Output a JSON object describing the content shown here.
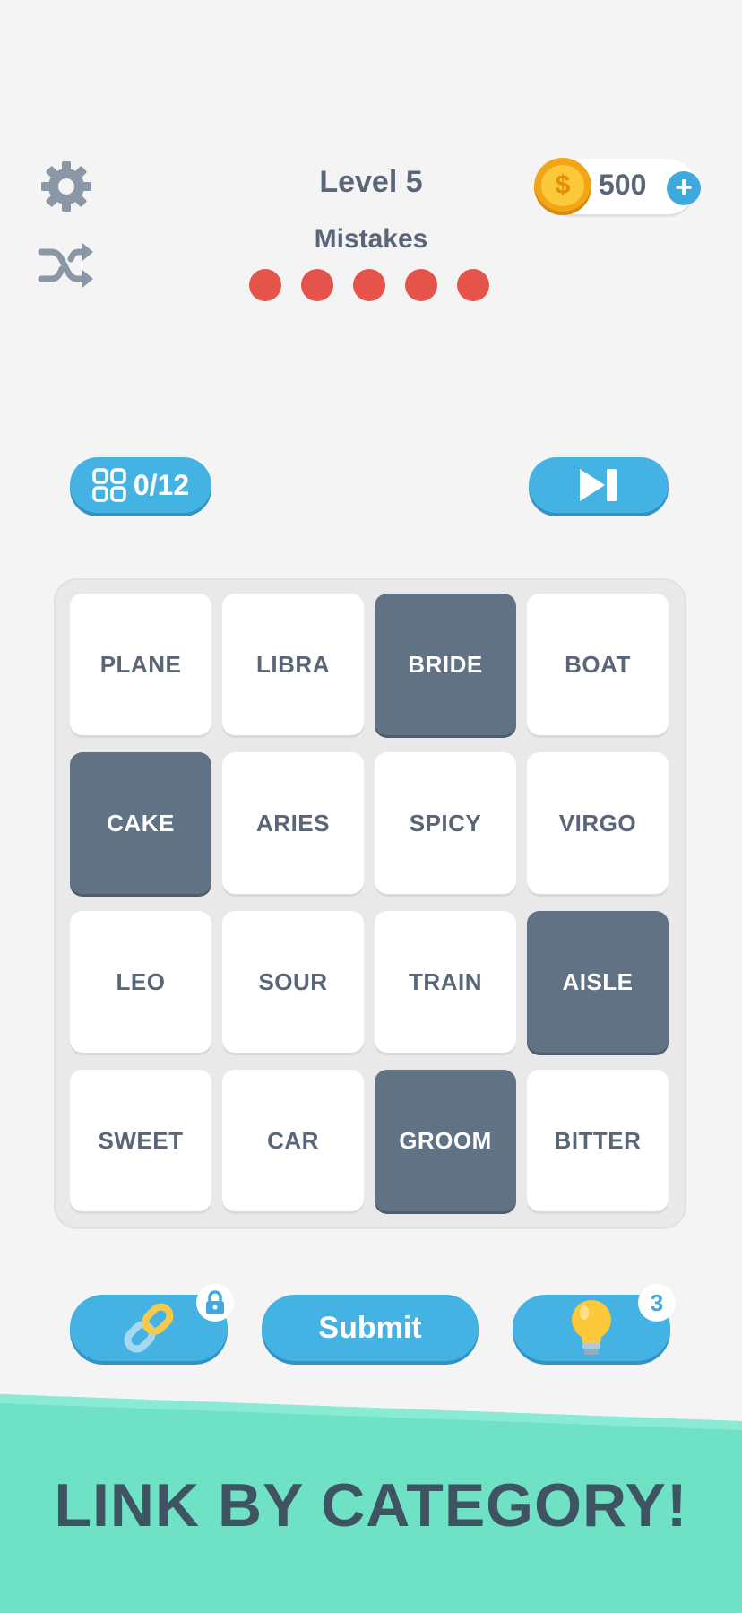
{
  "header": {
    "settings_icon": "gear-icon",
    "shuffle_icon": "shuffle-icon",
    "level_title": "Level 5",
    "mistakes_label": "Mistakes",
    "mistakes_remaining": 5,
    "mistake_dot_color": "#e5534b",
    "coins": {
      "value": "500",
      "coin_symbol": "$",
      "add_icon": "plus-icon"
    }
  },
  "toolbar": {
    "progress": "0/12",
    "progress_icon": "grid-icon",
    "skip_icon": "skip-forward-icon"
  },
  "board": {
    "tiles": [
      {
        "word": "PLANE",
        "selected": false
      },
      {
        "word": "LIBRA",
        "selected": false
      },
      {
        "word": "BRIDE",
        "selected": true
      },
      {
        "word": "BOAT",
        "selected": false
      },
      {
        "word": "CAKE",
        "selected": true
      },
      {
        "word": "ARIES",
        "selected": false
      },
      {
        "word": "SPICY",
        "selected": false
      },
      {
        "word": "VIRGO",
        "selected": false
      },
      {
        "word": "LEO",
        "selected": false
      },
      {
        "word": "SOUR",
        "selected": false
      },
      {
        "word": "TRAIN",
        "selected": false
      },
      {
        "word": "AISLE",
        "selected": true
      },
      {
        "word": "SWEET",
        "selected": false
      },
      {
        "word": "CAR",
        "selected": false
      },
      {
        "word": "GROOM",
        "selected": true
      },
      {
        "word": "BITTER",
        "selected": false
      }
    ]
  },
  "actions": {
    "link_icon": "chain-link-icon",
    "lock_icon": "lock-icon",
    "submit_label": "Submit",
    "hint_icon": "lightbulb-icon",
    "hint_count": "3"
  },
  "banner": {
    "text": "LINK BY CATEGORY!",
    "color": "#6fe1c5"
  },
  "colors": {
    "accent": "#45b2e4",
    "tile_selected": "#627285",
    "text": "#5a6677"
  }
}
